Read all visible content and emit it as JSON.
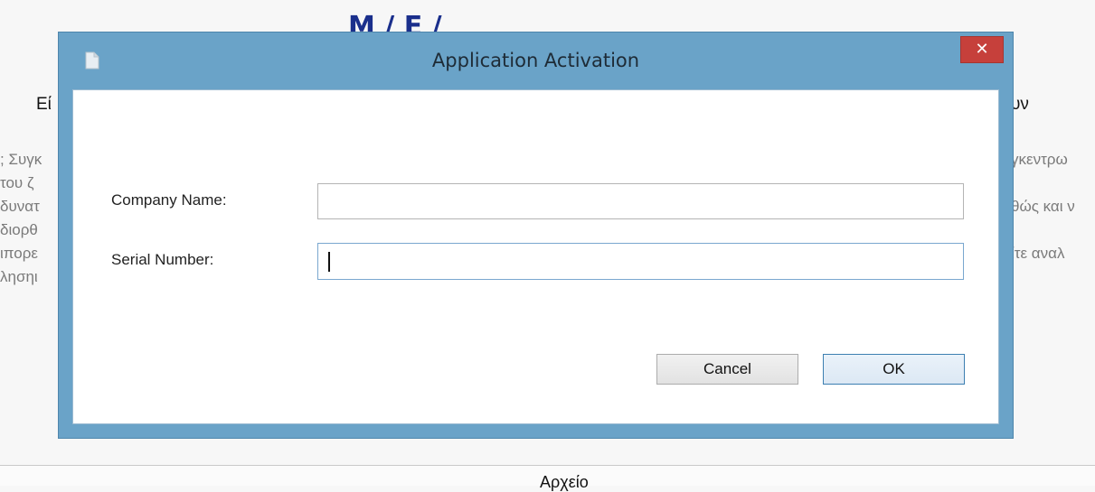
{
  "background": {
    "title_fragment": "Μ     /   Ε              /",
    "left_heading": "Εί",
    "right_heading": "υν",
    "left_lines": [
      "; Συγκ",
      "του ζ",
      "δυνατ",
      " διορθ",
      "ιπορε",
      "λησηι"
    ],
    "right_lines": [
      "γκεντρω",
      "",
      "θώς και ν",
      "",
      "ίτε αναλ",
      ""
    ],
    "bottom_label": "Αρχείο"
  },
  "dialog": {
    "title": "Application Activation",
    "close_glyph": "✕",
    "fields": {
      "company_name": {
        "label": "Company Name:",
        "value": ""
      },
      "serial_number": {
        "label": "Serial Number:",
        "value": ""
      }
    },
    "buttons": {
      "cancel": "Cancel",
      "ok": "OK"
    }
  },
  "colors": {
    "frame": "#6aa3c8",
    "close": "#c6403b",
    "bg_title": "#1a2f8c"
  },
  "icons": {
    "app": "document-icon",
    "close": "close-icon"
  }
}
